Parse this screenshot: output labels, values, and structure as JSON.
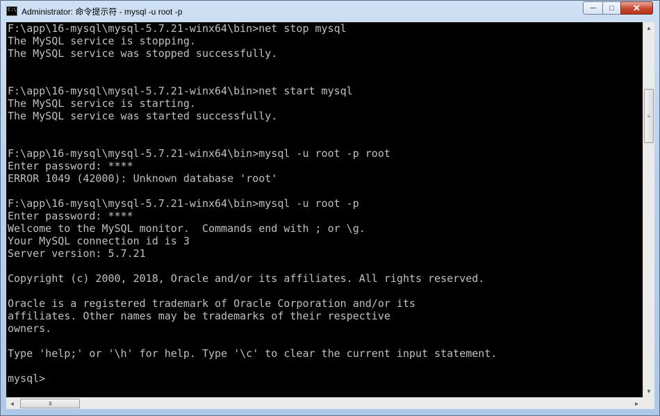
{
  "window": {
    "title": "Administrator: 命令提示符 - mysql  -u root -p",
    "controls": {
      "minimize": "─",
      "maximize": "□",
      "close": "✕"
    }
  },
  "console": {
    "lines": [
      "F:\\app\\16-mysql\\mysql-5.7.21-winx64\\bin>net stop mysql",
      "The MySQL service is stopping.",
      "The MySQL service was stopped successfully.",
      "",
      "",
      "F:\\app\\16-mysql\\mysql-5.7.21-winx64\\bin>net start mysql",
      "The MySQL service is starting.",
      "The MySQL service was started successfully.",
      "",
      "",
      "F:\\app\\16-mysql\\mysql-5.7.21-winx64\\bin>mysql -u root -p root",
      "Enter password: ****",
      "ERROR 1049 (42000): Unknown database 'root'",
      "",
      "F:\\app\\16-mysql\\mysql-5.7.21-winx64\\bin>mysql -u root -p",
      "Enter password: ****",
      "Welcome to the MySQL monitor.  Commands end with ; or \\g.",
      "Your MySQL connection id is 3",
      "Server version: 5.7.21",
      "",
      "Copyright (c) 2000, 2018, Oracle and/or its affiliates. All rights reserved.",
      "",
      "Oracle is a registered trademark of Oracle Corporation and/or its",
      "affiliates. Other names may be trademarks of their respective",
      "owners.",
      "",
      "Type 'help;' or '\\h' for help. Type '\\c' to clear the current input statement.",
      "",
      "mysql>"
    ]
  },
  "scrollbars": {
    "up_arrow": "▲",
    "down_arrow": "▼",
    "left_arrow": "◄",
    "right_arrow": "►",
    "v_grip": "≡",
    "h_grip": "III"
  }
}
